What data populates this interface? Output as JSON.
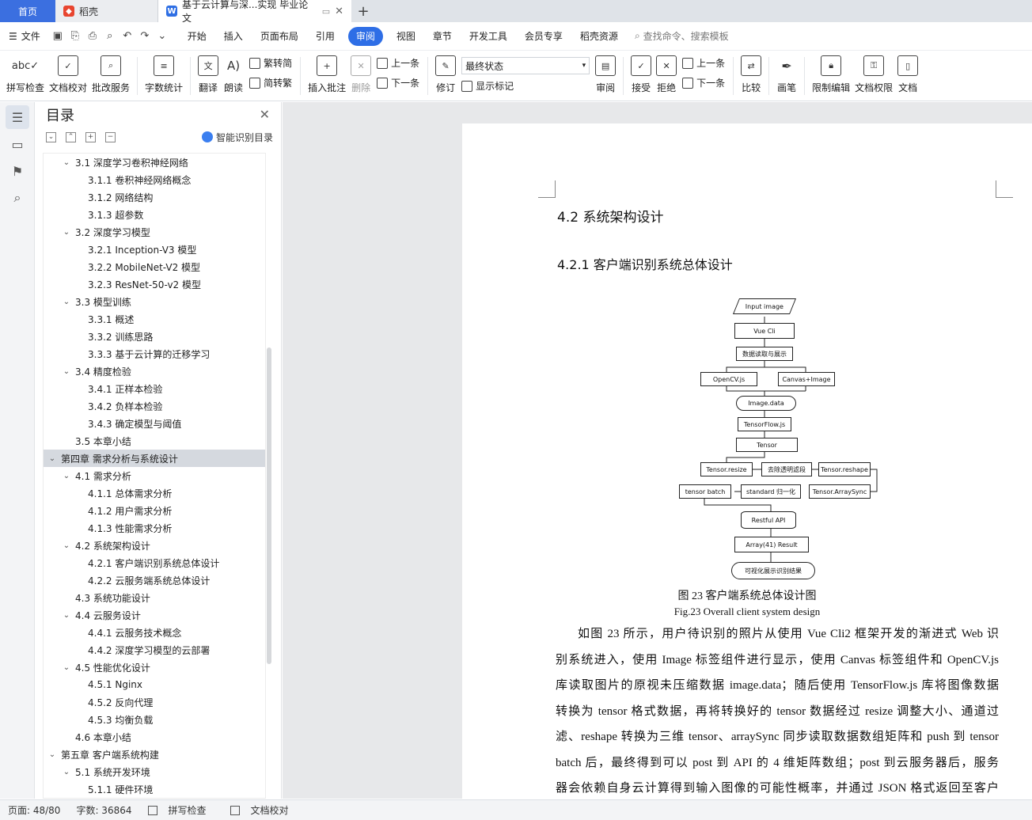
{
  "tabs": {
    "home": "首页",
    "wps": "稻壳",
    "doc": "基于云计算与深...实现 毕业论文",
    "add": "+"
  },
  "menu": {
    "file": "文件",
    "items": [
      "开始",
      "插入",
      "页面布局",
      "引用",
      "审阅",
      "视图",
      "章节",
      "开发工具",
      "会员专享",
      "稻壳资源"
    ],
    "active": "审阅",
    "search_placeholder": "查找命令、搜索模板"
  },
  "ribbon": {
    "spell": "拼写检查",
    "proof": "文档校对",
    "batch": "批改服务",
    "wordcount": "字数统计",
    "translate": "翻译",
    "read": "朗读",
    "trad": "繁转简",
    "simp": "简转繁",
    "insert_comment": "插入批注",
    "delete": "删除",
    "prev": "上一条",
    "next": "下一条",
    "revise": "修订",
    "state": "最终状态",
    "show_marks": "显示标记",
    "review": "审阅",
    "accept": "接受",
    "reject": "拒绝",
    "prev2": "上一条",
    "next2": "下一条",
    "compare": "比较",
    "pen": "画笔",
    "restrict": "限制编辑",
    "perm": "文档权限",
    "more": "文档"
  },
  "toc": {
    "title": "目录",
    "smart": "智能识别目录",
    "items": [
      {
        "level": 2,
        "arrow": "v",
        "text": "3.1  深度学习卷积神经网络"
      },
      {
        "level": 3,
        "text": "3.1.1  卷积神经网络概念"
      },
      {
        "level": 3,
        "text": "3.1.2  网络结构"
      },
      {
        "level": 3,
        "text": "3.1.3  超参数"
      },
      {
        "level": 2,
        "arrow": "v",
        "text": "3.2  深度学习模型"
      },
      {
        "level": 3,
        "text": "3.2.1 Inception-V3 模型"
      },
      {
        "level": 3,
        "text": "3.2.2 MobileNet-V2 模型"
      },
      {
        "level": 3,
        "text": "3.2.3 ResNet-50-v2 模型"
      },
      {
        "level": 2,
        "arrow": "v",
        "text": "3.3  模型训练"
      },
      {
        "level": 3,
        "text": "3.3.1  概述"
      },
      {
        "level": 3,
        "text": "3.3.2  训练思路"
      },
      {
        "level": 3,
        "text": "3.3.3  基于云计算的迁移学习"
      },
      {
        "level": 2,
        "arrow": "v",
        "text": "3.4  精度检验"
      },
      {
        "level": 3,
        "text": "3.4.1  正样本检验"
      },
      {
        "level": 3,
        "text": "3.4.2  负样本检验"
      },
      {
        "level": 3,
        "text": "3.4.3  确定模型与阈值"
      },
      {
        "level": 2,
        "text": "3.5  本章小结"
      },
      {
        "level": 1,
        "arrow": "v",
        "text": "第四章  需求分析与系统设计",
        "selected": true
      },
      {
        "level": 2,
        "arrow": "v",
        "text": "4.1  需求分析"
      },
      {
        "level": 3,
        "text": "4.1.1  总体需求分析"
      },
      {
        "level": 3,
        "text": "4.1.2  用户需求分析"
      },
      {
        "level": 3,
        "text": "4.1.3  性能需求分析"
      },
      {
        "level": 2,
        "arrow": "v",
        "text": "4.2  系统架构设计"
      },
      {
        "level": 3,
        "text": "4.2.1  客户端识别系统总体设计"
      },
      {
        "level": 3,
        "text": "4.2.2  云服务端系统总体设计"
      },
      {
        "level": 2,
        "text": "4.3  系统功能设计"
      },
      {
        "level": 2,
        "arrow": "v",
        "text": "4.4  云服务设计"
      },
      {
        "level": 3,
        "text": "4.4.1  云服务技术概念"
      },
      {
        "level": 3,
        "text": "4.4.2 深度学习模型的云部署"
      },
      {
        "level": 2,
        "arrow": "v",
        "text": "4.5  性能优化设计"
      },
      {
        "level": 3,
        "text": "4.5.1 Nginx"
      },
      {
        "level": 3,
        "text": "4.5.2  反向代理"
      },
      {
        "level": 3,
        "text": "4.5.3  均衡负载"
      },
      {
        "level": 2,
        "text": "4.6 本章小结"
      },
      {
        "level": 1,
        "arrow": "v",
        "text": "第五章  客户端系统构建"
      },
      {
        "level": 2,
        "arrow": "v",
        "text": "5.1 系统开发环境"
      },
      {
        "level": 3,
        "text": "5.1.1  硬件环境"
      }
    ]
  },
  "doc": {
    "h2": "4.2  系统架构设计",
    "h3": "4.2.1  客户端识别系统总体设计",
    "flow": {
      "input": "Input image",
      "vue": "Vue Cli",
      "read": "数据读取与展示",
      "opencv": "OpenCV.js",
      "canvas": "Canvas+Image",
      "imgdata": "Image.data",
      "tfjs": "TensorFlow.js",
      "tensor": "Tensor",
      "resize": "Tensor.resize",
      "filter": "去除透明滤段",
      "reshape": "Tensor.reshape",
      "batch": "tensor batch",
      "standard": "standard 归一化",
      "arraysync": "Tensor.ArraySync",
      "api": "Restful API",
      "result": "Array(41) Result",
      "show": "可视化展示识别结果"
    },
    "caption_cn": "图 23  客户端系统总体设计图",
    "caption_en": "Fig.23 Overall client system design",
    "para": [
      "如图 23 所示，用户待识别的照片从使用 Vue Cli2 框架开发的渐进式 Web 识",
      "别系统进入，使用 Image 标签组件进行显示，使用 Canvas 标签组件和 OpenCV.js",
      "库读取图片的原视未压缩数据 image.data；随后使用 TensorFlow.js 库将图像数据",
      "转换为 tensor 格式数据，再将转换好的 tensor 数据经过 resize 调整大小、通道过",
      "滤、reshape 转换为三维 tensor、arraySync 同步读取数据数组矩阵和 push 到 tensor",
      "batch 后，最终得到可以 post 到 API 的 4 维矩阵数组；post 到云服务器后，服务",
      "器会依赖自身云计算得到输入图像的可能性概率，并通过 JSON 格式返回至客户"
    ]
  },
  "status": {
    "page": "页面: 48/80",
    "words": "字数: 36864",
    "spell": "拼写检查",
    "proof": "文档校对"
  }
}
